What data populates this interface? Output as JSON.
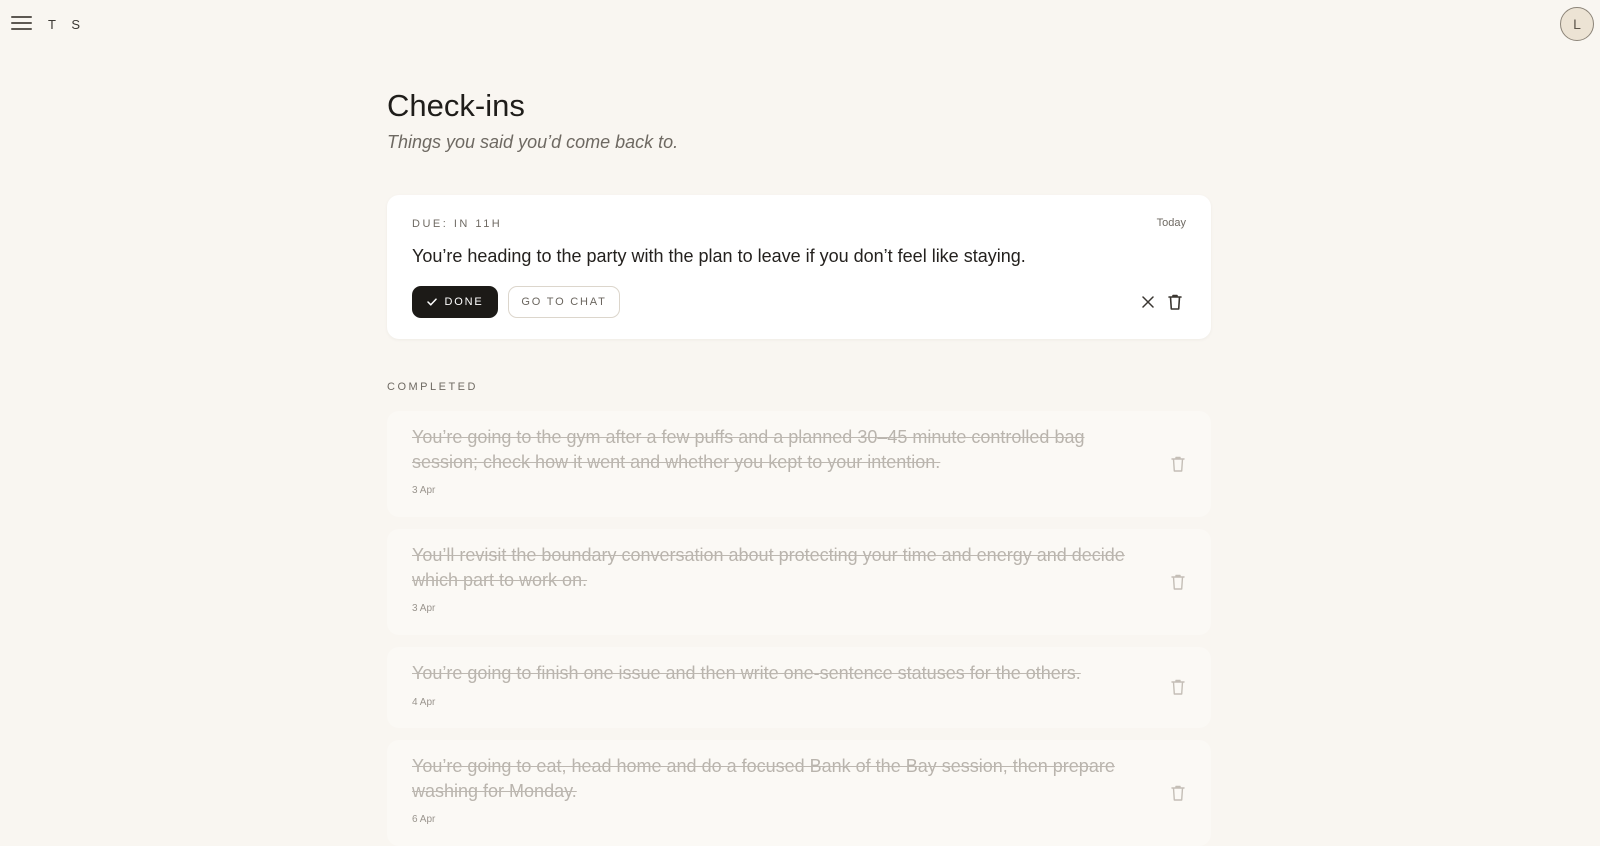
{
  "header": {
    "brand": "T S",
    "avatar_initial": "L",
    "icons": {
      "menu": "hamburger-menu-icon"
    }
  },
  "page": {
    "title": "Check-ins",
    "subtitle": "Things you said you’d come back to."
  },
  "active": {
    "due_label": "DUE: IN 11H",
    "when": "Today",
    "text": "You’re heading to the party with the plan to leave if you don’t feel like staying.",
    "done_label": "DONE",
    "chat_label": "GO TO CHAT",
    "icons": {
      "done": "check-icon",
      "dismiss": "close-icon",
      "delete": "trash-icon"
    }
  },
  "completed": {
    "label": "COMPLETED",
    "items": [
      {
        "text": "You’re going to the gym after a few puffs and a planned 30–45 minute controlled bag session; check how it went and whether you kept to your intention.",
        "date": "3 Apr"
      },
      {
        "text": "You’ll revisit the boundary conversation about protecting your time and energy and decide which part to work on.",
        "date": "3 Apr"
      },
      {
        "text": "You’re going to finish one issue and then write one-sentence statuses for the others.",
        "date": "4 Apr"
      },
      {
        "text": "You’re going to eat, head home and do a focused Bank of the Bay session, then prepare washing for Monday.",
        "date": "6 Apr"
      }
    ]
  },
  "colors": {
    "background": "#f9f6f1",
    "card": "#ffffff",
    "completed_card": "#fbf9f5",
    "primary_button": "#1c1a17",
    "muted_text": "#b9b4ad"
  }
}
